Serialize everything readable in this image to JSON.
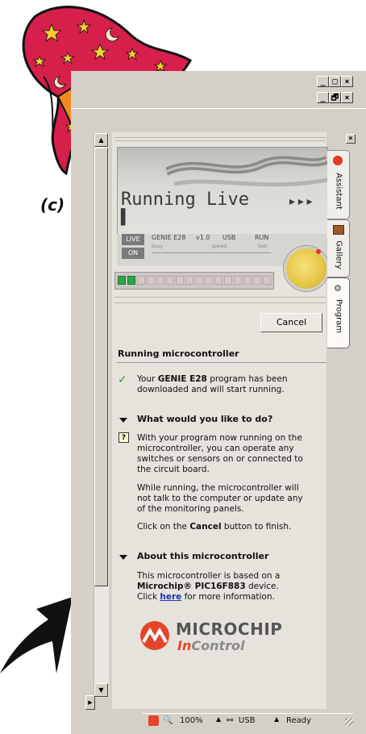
{
  "caption": "(c)",
  "window": {
    "controls_outer": [
      "_",
      "□",
      "×"
    ],
    "controls_inner": [
      "_",
      "🗗",
      "×"
    ],
    "panel_close": "×"
  },
  "lcd": {
    "main_text": "Running Live",
    "arrows": "▸▸▸",
    "cursor": "▌",
    "pill_live": "LIVE",
    "pill_on": "ON",
    "device": "GENIE E28",
    "version": "v1.0",
    "connection": "USB",
    "mode": "RUN",
    "sub_labels": [
      "busy",
      "speed",
      "test"
    ],
    "leds_on": 2,
    "leds_total": 16
  },
  "buttons": {
    "cancel": "Cancel"
  },
  "tabs": [
    {
      "label": "Assistant",
      "icon": "tomato-icon"
    },
    {
      "label": "Gallery",
      "icon": "gallery-box-icon"
    },
    {
      "label": "Program",
      "icon": "program-icon"
    }
  ],
  "content": {
    "title": "Running microcontroller",
    "downloaded_pre": "Your ",
    "downloaded_bold": "GENIE E28",
    "downloaded_post": " program has been downloaded and will start running.",
    "section1_heading": "What would you like to do?",
    "para1": "With your program now running on the microcontroller, you can operate any switches or sensors on or connected to the circuit board.",
    "para2": "While running, the microcontroller will not talk to the computer or update any of the monitoring panels.",
    "para3_pre": "Click on the ",
    "para3_bold": "Cancel",
    "para3_post": " button to finish.",
    "section2_heading": "About this microcontroller",
    "about_pre": "This microcontroller is based on a ",
    "about_bold": "Microchip® PIC16F883",
    "about_post": " device.",
    "about_click": "Click ",
    "about_link": "here",
    "about_tail": " for more information.",
    "logo_main": "MICROCHIP",
    "logo_sub_in": "In",
    "logo_sub_rest": "Control"
  },
  "statusbar": {
    "zoom": "100%",
    "connection": "USB",
    "status": "Ready"
  },
  "colors": {
    "accent_red": "#e4452a",
    "hat_red": "#d61f4a",
    "star_yellow": "#f5d130",
    "link": "#1a33b3"
  }
}
